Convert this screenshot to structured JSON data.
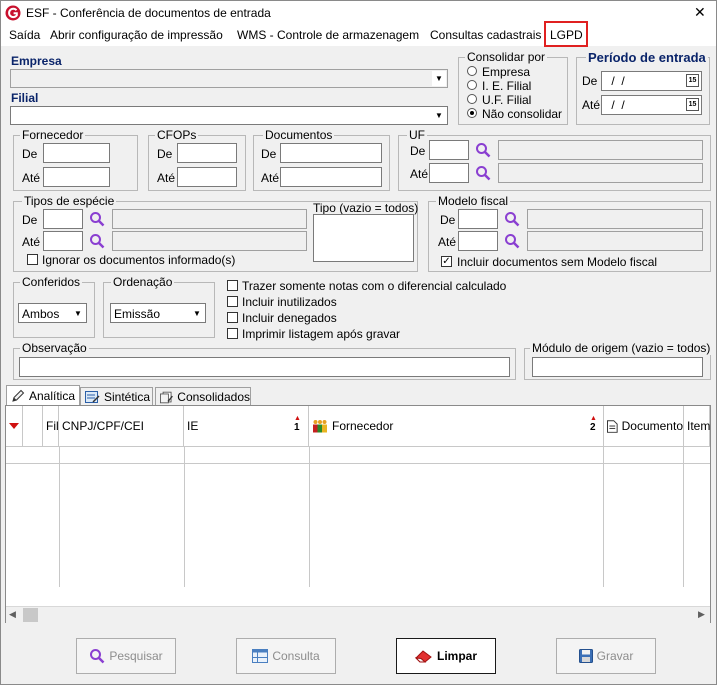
{
  "window": {
    "title": "ESF - Conferência de documentos de entrada",
    "close_glyph": "✕"
  },
  "menu": {
    "items": [
      "Saída",
      "Abrir configuração de impressão",
      "WMS - Controle de armazenagem",
      "Consultas cadastrais",
      "LGPD"
    ]
  },
  "empresa": {
    "label": "Empresa",
    "value": ""
  },
  "filial": {
    "label": "Filial",
    "value": ""
  },
  "consolidar": {
    "label": "Consolidar por",
    "options": [
      "Empresa",
      "I. E. Filial",
      "U.F. Filial",
      "Não consolidar"
    ],
    "selected": "Não consolidar"
  },
  "periodo": {
    "label": "Período de entrada",
    "de_label": "De",
    "ate_label": "Até",
    "de_value": " /  /",
    "ate_value": " /  /",
    "calendar_text": "15"
  },
  "fornecedor": {
    "label": "Fornecedor",
    "de_label": "De",
    "ate_label": "Até"
  },
  "cfops": {
    "label": "CFOPs",
    "de_label": "De",
    "ate_label": "Até"
  },
  "documentos": {
    "label": "Documentos",
    "de_label": "De",
    "ate_label": "Até"
  },
  "uf": {
    "label": "UF",
    "de_label": "De",
    "ate_label": "Até"
  },
  "tipos_especie": {
    "label": "Tipos de espécie",
    "de_label": "De",
    "ate_label": "Até",
    "ignorar_label": "Ignorar os documentos informado(s)",
    "ignorar_checked": false
  },
  "tipo": {
    "label": "Tipo (vazio = todos)"
  },
  "modelo_fiscal": {
    "label": "Modelo fiscal",
    "de_label": "De",
    "ate_label": "Até",
    "incluir_label": "Incluir documentos sem Modelo fiscal",
    "incluir_checked": true
  },
  "conferidos": {
    "label": "Conferidos",
    "value": "Ambos"
  },
  "ordenacao": {
    "label": "Ordenação",
    "value": "Emissão"
  },
  "options": {
    "trazer": "Trazer somente notas com o diferencial calculado",
    "inutilizados": "Incluir inutilizados",
    "denegados": "Incluir denegados",
    "imprimir": "Imprimir listagem após gravar"
  },
  "observacao": {
    "label": "Observação"
  },
  "modulo_origem": {
    "label": "Módulo de origem (vazio = todos)"
  },
  "tabs": [
    "Analítica",
    "Sintética",
    "Consolidados"
  ],
  "grid": {
    "columns": [
      "Fil",
      "CNPJ/CPF/CEI",
      "IE",
      "Fornecedor",
      "Documento",
      "Item"
    ],
    "sort_ie": "1",
    "sort_fornecedor": "2"
  },
  "buttons": {
    "pesquisar": "Pesquisar",
    "consulta": "Consulta",
    "limpar": "Limpar",
    "gravar": "Gravar"
  },
  "colors": {
    "accent_red": "#e02020",
    "navy": "#0a246a",
    "search_purple": "#8a3fd1"
  }
}
